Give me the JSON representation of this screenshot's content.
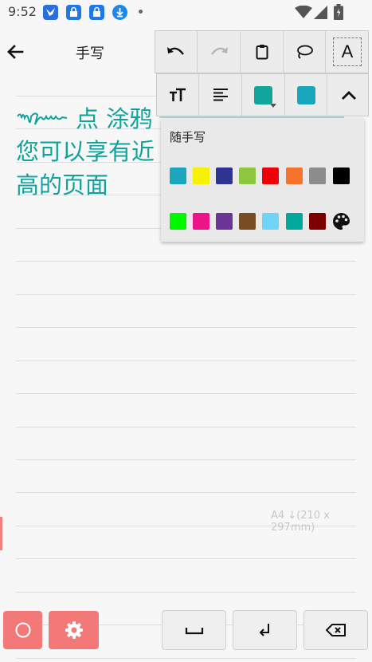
{
  "status_bar": {
    "time": "9:52",
    "icons": [
      "app-icon-bird",
      "app-icon-lock-1",
      "app-icon-lock-2",
      "download-icon",
      "notification-dot",
      "wifi-icon",
      "signal-icon",
      "battery-icon"
    ]
  },
  "appbar": {
    "title": "手写",
    "back_icon": "arrow-left-icon"
  },
  "toolbar": {
    "row1": [
      "undo-icon",
      "redo-icon",
      "clipboard-icon",
      "lasso-icon",
      "text-mode-icon"
    ],
    "text_mode_label": "A",
    "row2": [
      "text-size-icon",
      "align-icon",
      "pen-color",
      "highlight-color",
      "collapse-icon"
    ],
    "pen_color": "#12a59e",
    "highlight_color": "#18a6bd"
  },
  "handwriting": {
    "line1": "点 涂鸦",
    "line2": "您可以享有近",
    "line3": "高的页面",
    "color": "#11a29b"
  },
  "color_popup": {
    "title": "随手写",
    "row1": [
      "#1aa6bf",
      "#f6f200",
      "#2d3491",
      "#8dc63f",
      "#ef0007",
      "#f5732a",
      "#8c8c8c",
      "#000000"
    ],
    "row2": [
      "#00f900",
      "#ec1489",
      "#6b3595",
      "#794d24",
      "#6fd4f7",
      "#02a89b",
      "#7d0000"
    ],
    "palette_icon": "palette-icon"
  },
  "page": {
    "size_label": "A4 ↓(210 x 297mm)"
  },
  "bottom_bar": {
    "circle_icon": "circle-icon",
    "settings_icon": "gear-icon",
    "space_icon": "space-icon",
    "enter_icon": "enter-icon",
    "backspace_icon": "backspace-icon"
  }
}
